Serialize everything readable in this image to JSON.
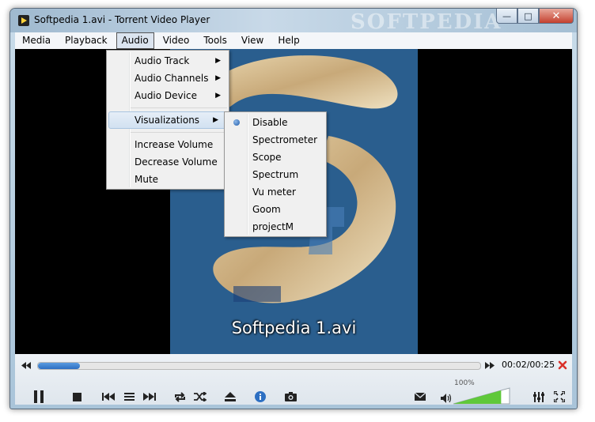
{
  "window": {
    "title": "Softpedia 1.avi - Torrent Video Player",
    "watermark": "SOFTPEDIA"
  },
  "menubar": [
    "Media",
    "Playback",
    "Audio",
    "Video",
    "Tools",
    "View",
    "Help"
  ],
  "audio_menu": {
    "items": [
      "Audio Track",
      "Audio Channels",
      "Audio Device"
    ],
    "visualizations": "Visualizations",
    "items2": [
      "Increase Volume",
      "Decrease Volume",
      "Mute"
    ]
  },
  "viz_menu": [
    "Disable",
    "Spectrometer",
    "Scope",
    "Spectrum",
    "Vu meter",
    "Goom",
    "projectM"
  ],
  "video": {
    "subtitle": "Softpedia 1.avi"
  },
  "playback": {
    "time": "00:02/00:25",
    "progress": 0.095
  },
  "volume": {
    "percent": "100%",
    "level": 1.0
  },
  "colors": {
    "accent": "#2d6fc2",
    "close": "#d9302a",
    "volume": "#5fc83a"
  }
}
